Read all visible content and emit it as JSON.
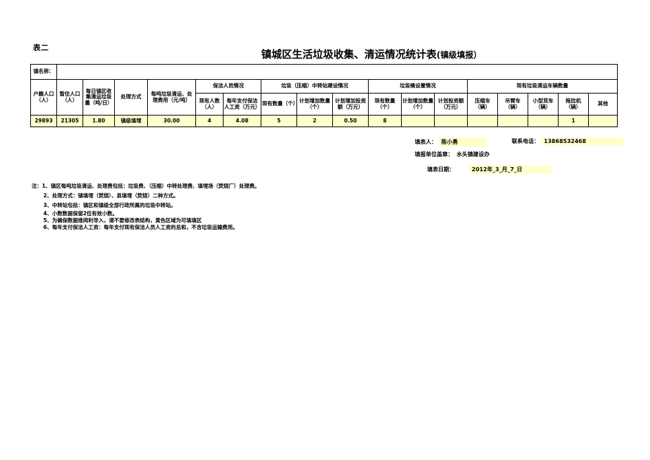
{
  "sheet_label": "表二",
  "title": {
    "main": "镇城区生活垃圾收集、清运情况统计表",
    "suffix": "(镇级填报）"
  },
  "table": {
    "town_name_label": "镇名称：",
    "town_name_value": "",
    "groups": {
      "cleaner_staff": "保洁人员情况",
      "transfer_station": "垃圾（压缩）中转站建设情况",
      "bins": "垃圾桶设置情况",
      "vehicles": "现有垃圾清运车辆数量"
    },
    "columns": [
      "户籍人口（人）",
      "暂住人口（人）",
      "每日镇区收集清运垃圾量（吨/日）",
      "处理方式",
      "每吨垃圾清运、处理费用（元/吨）",
      "现有人数（人）",
      "每年支付保洁人工资（万元）",
      "现有数量（个）",
      "计划增加数量（个）",
      "计划增加投资额（万元）",
      "现有数量（个）",
      "计划增加数量（个）",
      "计划投资额（万元）",
      "压缩车（辆）",
      "吊臂车（辆）",
      "小型货车（辆）",
      "拖拉机（辆）",
      "其他"
    ],
    "row": [
      "29893",
      "21305",
      "1.80",
      "镇级填埋",
      "30.00",
      "4",
      "4.08",
      "5",
      "2",
      "0.50",
      "8",
      "",
      "",
      "",
      "",
      "",
      "1",
      ""
    ]
  },
  "footer": {
    "reporter_label": "填表人：",
    "reporter_value": "陈小勇",
    "phone_label": "联系电话：",
    "phone_value": "13868532468",
    "unit_label": "填报单位盖章：",
    "unit_value": "水头镇建设办",
    "date_label": "填表日期：",
    "date_value": "2012年_3_月_7_日"
  },
  "notes": [
    "注：1、镇区每吨垃圾清运、处理费包括：垃圾费、（压缩）中转处理费、填埋场（焚烧厂）处理费。",
    "2、处理方式：镇填埋（焚烧）、县填埋（焚烧）二种方式。",
    "3、中转站包括：镇区和镇级全部行政所属的垃圾中转站。",
    "4、小数数据保留2位有效小数。",
    "5、为确保数据维阅利导入，请不要修改表结构，黄色区域为可填填区",
    "6、每年支付保洁人工资：每年支付现有保洁人员人工资的总和，不含垃圾运输费用。"
  ]
}
